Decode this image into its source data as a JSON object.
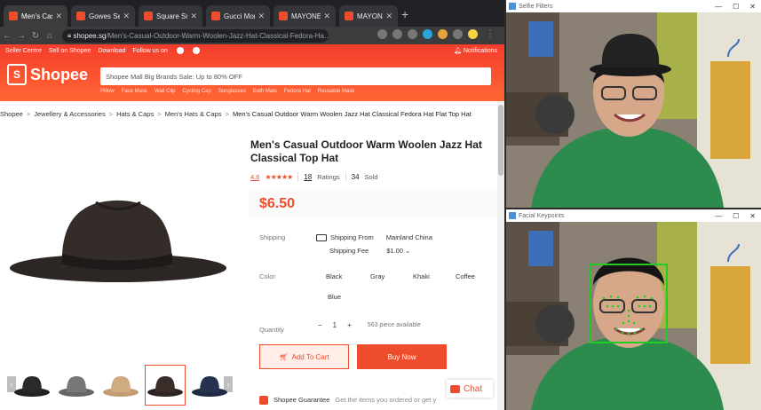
{
  "browser": {
    "tabs": [
      {
        "label": "Men's Casu",
        "active": true
      },
      {
        "label": "Gowes Seli",
        "active": false
      },
      {
        "label": "Square Sun",
        "active": false
      },
      {
        "label": "Gucci Mont",
        "active": false
      },
      {
        "label": "MAYONETTI",
        "active": false
      },
      {
        "label": "MAYONETT",
        "active": false
      }
    ],
    "url_host": "shopee.sg",
    "url_path": "/Men's-Casual-Outdoor-Warm-Woolen-Jazz-Hat-Classical-Fedora-Ha..."
  },
  "shopee": {
    "toplinks": [
      "Seller Centre",
      "Sell on Shopee",
      "Download",
      "Follow us on"
    ],
    "notifications": "Notifications",
    "logo_text": "Shopee",
    "search_placeholder": "Shopee Mall Big Brands Sale: Up to 80% OFF",
    "suggestions": [
      "Pillow",
      "Face Mask",
      "Wall Clip",
      "Cycling Cap",
      "Sunglasses",
      "Bath Mats",
      "Fedora Hat",
      "Reusable Mask"
    ],
    "breadcrumb": [
      "Shopee",
      "Jewellery & Accessories",
      "Hats & Caps",
      "Men's Hats & Caps",
      "Men's Casual Outdoor Warm Woolen Jazz Hat Classical Fedora Hat Flat Top Hat"
    ],
    "product": {
      "title": "Men's Casual Outdoor Warm Woolen Jazz Hat Classical Top Hat",
      "rating": "4.6",
      "stars": "★★★★★",
      "ratings_count": "18",
      "ratings_label": "Ratings",
      "sold_count": "34",
      "sold_label": "Sold",
      "price": "$6.50",
      "shipping_label": "Shipping",
      "shipping_from_label": "Shipping From",
      "shipping_from_value": "Mainland China",
      "shipping_fee_label": "Shipping Fee",
      "shipping_fee_value": "$1.00",
      "color_label": "Color",
      "colors": [
        "Black",
        "Gray",
        "Khaki",
        "Coffee",
        "Blue"
      ],
      "quantity_label": "Quantity",
      "quantity_value": "1",
      "minus": "−",
      "plus": "+",
      "available": "563 piece available",
      "add_to_cart": "Add To Cart",
      "buy_now": "Buy Now",
      "guarantee_title": "Shopee Guarantee",
      "guarantee_desc": "Get the items you ordered or get y"
    },
    "chat_label": "Chat"
  },
  "camera_windows": [
    {
      "title": "Selfie Filters",
      "overlay": "hat"
    },
    {
      "title": "Facial Keypoints",
      "overlay": "box"
    }
  ],
  "colors": {
    "brand": "#ee4d2d",
    "shirt": "#2e8b4e",
    "bbox": "#22cc22"
  },
  "icons": [
    "back-icon",
    "forward-icon",
    "reload-icon",
    "home-icon",
    "lock-icon",
    "star-icon",
    "truck-icon",
    "cart-icon",
    "chat-icon"
  ]
}
